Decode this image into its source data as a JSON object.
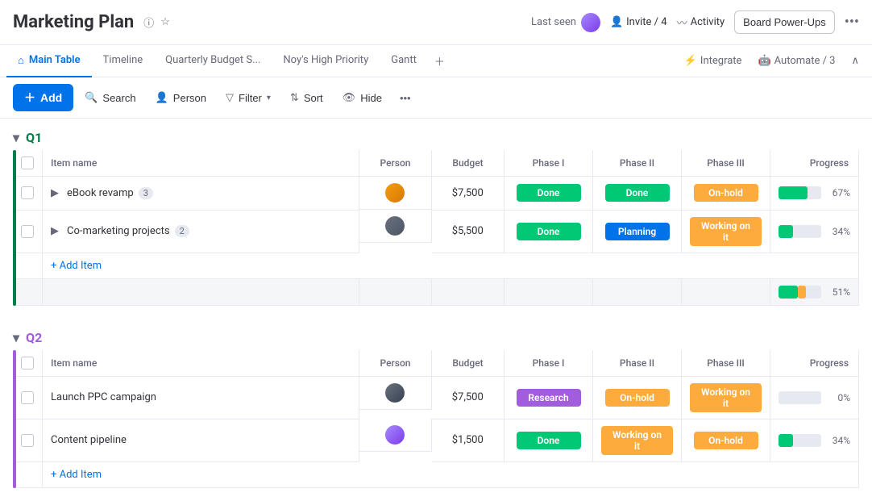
{
  "header": {
    "title": "Marketing Plan",
    "last_seen_label": "Last seen",
    "invite_label": "Invite / 4",
    "activity_label": "Activity",
    "board_powerups_label": "Board Power-Ups"
  },
  "tabs": {
    "items": [
      {
        "label": "Main Table",
        "active": true
      },
      {
        "label": "Timeline",
        "active": false
      },
      {
        "label": "Quarterly Budget S...",
        "active": false
      },
      {
        "label": "Noy's High Priority",
        "active": false
      },
      {
        "label": "Gantt",
        "active": false
      }
    ],
    "integrate_label": "Integrate",
    "automate_label": "Automate / 3"
  },
  "toolbar": {
    "add_label": "Add",
    "search_label": "Search",
    "person_label": "Person",
    "filter_label": "Filter",
    "sort_label": "Sort",
    "hide_label": "Hide"
  },
  "groups": [
    {
      "id": "q1",
      "label": "Q1",
      "color": "q1",
      "columns": [
        "Item name",
        "Person",
        "Budget",
        "Phase I",
        "Phase II",
        "Phase III",
        "Progress"
      ],
      "rows": [
        {
          "name": "eBook revamp",
          "count": 3,
          "budget": "$7,500",
          "phase1": "Done",
          "phase1_class": "done",
          "phase2": "Done",
          "phase2_class": "done",
          "phase3": "On-hold",
          "phase3_class": "onhold",
          "progress": 67,
          "progress_green": 67,
          "progress_orange": 0,
          "has_expand": true
        },
        {
          "name": "Co-marketing projects",
          "count": 2,
          "budget": "$5,500",
          "phase1": "Done",
          "phase1_class": "done",
          "phase2": "Planning",
          "phase2_class": "planning",
          "phase3": "Working on it",
          "phase3_class": "working",
          "progress": 34,
          "progress_green": 34,
          "progress_orange": 0,
          "has_expand": true
        }
      ],
      "summary_progress_green": 45,
      "summary_progress_orange": 20,
      "summary_pct": "51%",
      "add_item_label": "+ Add Item"
    },
    {
      "id": "q2",
      "label": "Q2",
      "color": "q2",
      "columns": [
        "Item name",
        "Person",
        "Budget",
        "Phase I",
        "Phase II",
        "Phase III",
        "Progress"
      ],
      "rows": [
        {
          "name": "Launch PPC campaign",
          "count": null,
          "budget": "$7,500",
          "phase1": "Research",
          "phase1_class": "research",
          "phase2": "On-hold",
          "phase2_class": "onhold",
          "phase3": "Working on it",
          "phase3_class": "working",
          "progress": 0,
          "progress_green": 0,
          "progress_orange": 0,
          "has_expand": false
        },
        {
          "name": "Content pipeline",
          "count": null,
          "budget": "$1,500",
          "phase1": "Done",
          "phase1_class": "done",
          "phase2": "Working on it",
          "phase2_class": "working",
          "phase3": "On-hold",
          "phase3_class": "onhold",
          "progress": 34,
          "progress_green": 34,
          "progress_orange": 0,
          "has_expand": false
        }
      ],
      "add_item_label": "+ Add Item"
    }
  ]
}
